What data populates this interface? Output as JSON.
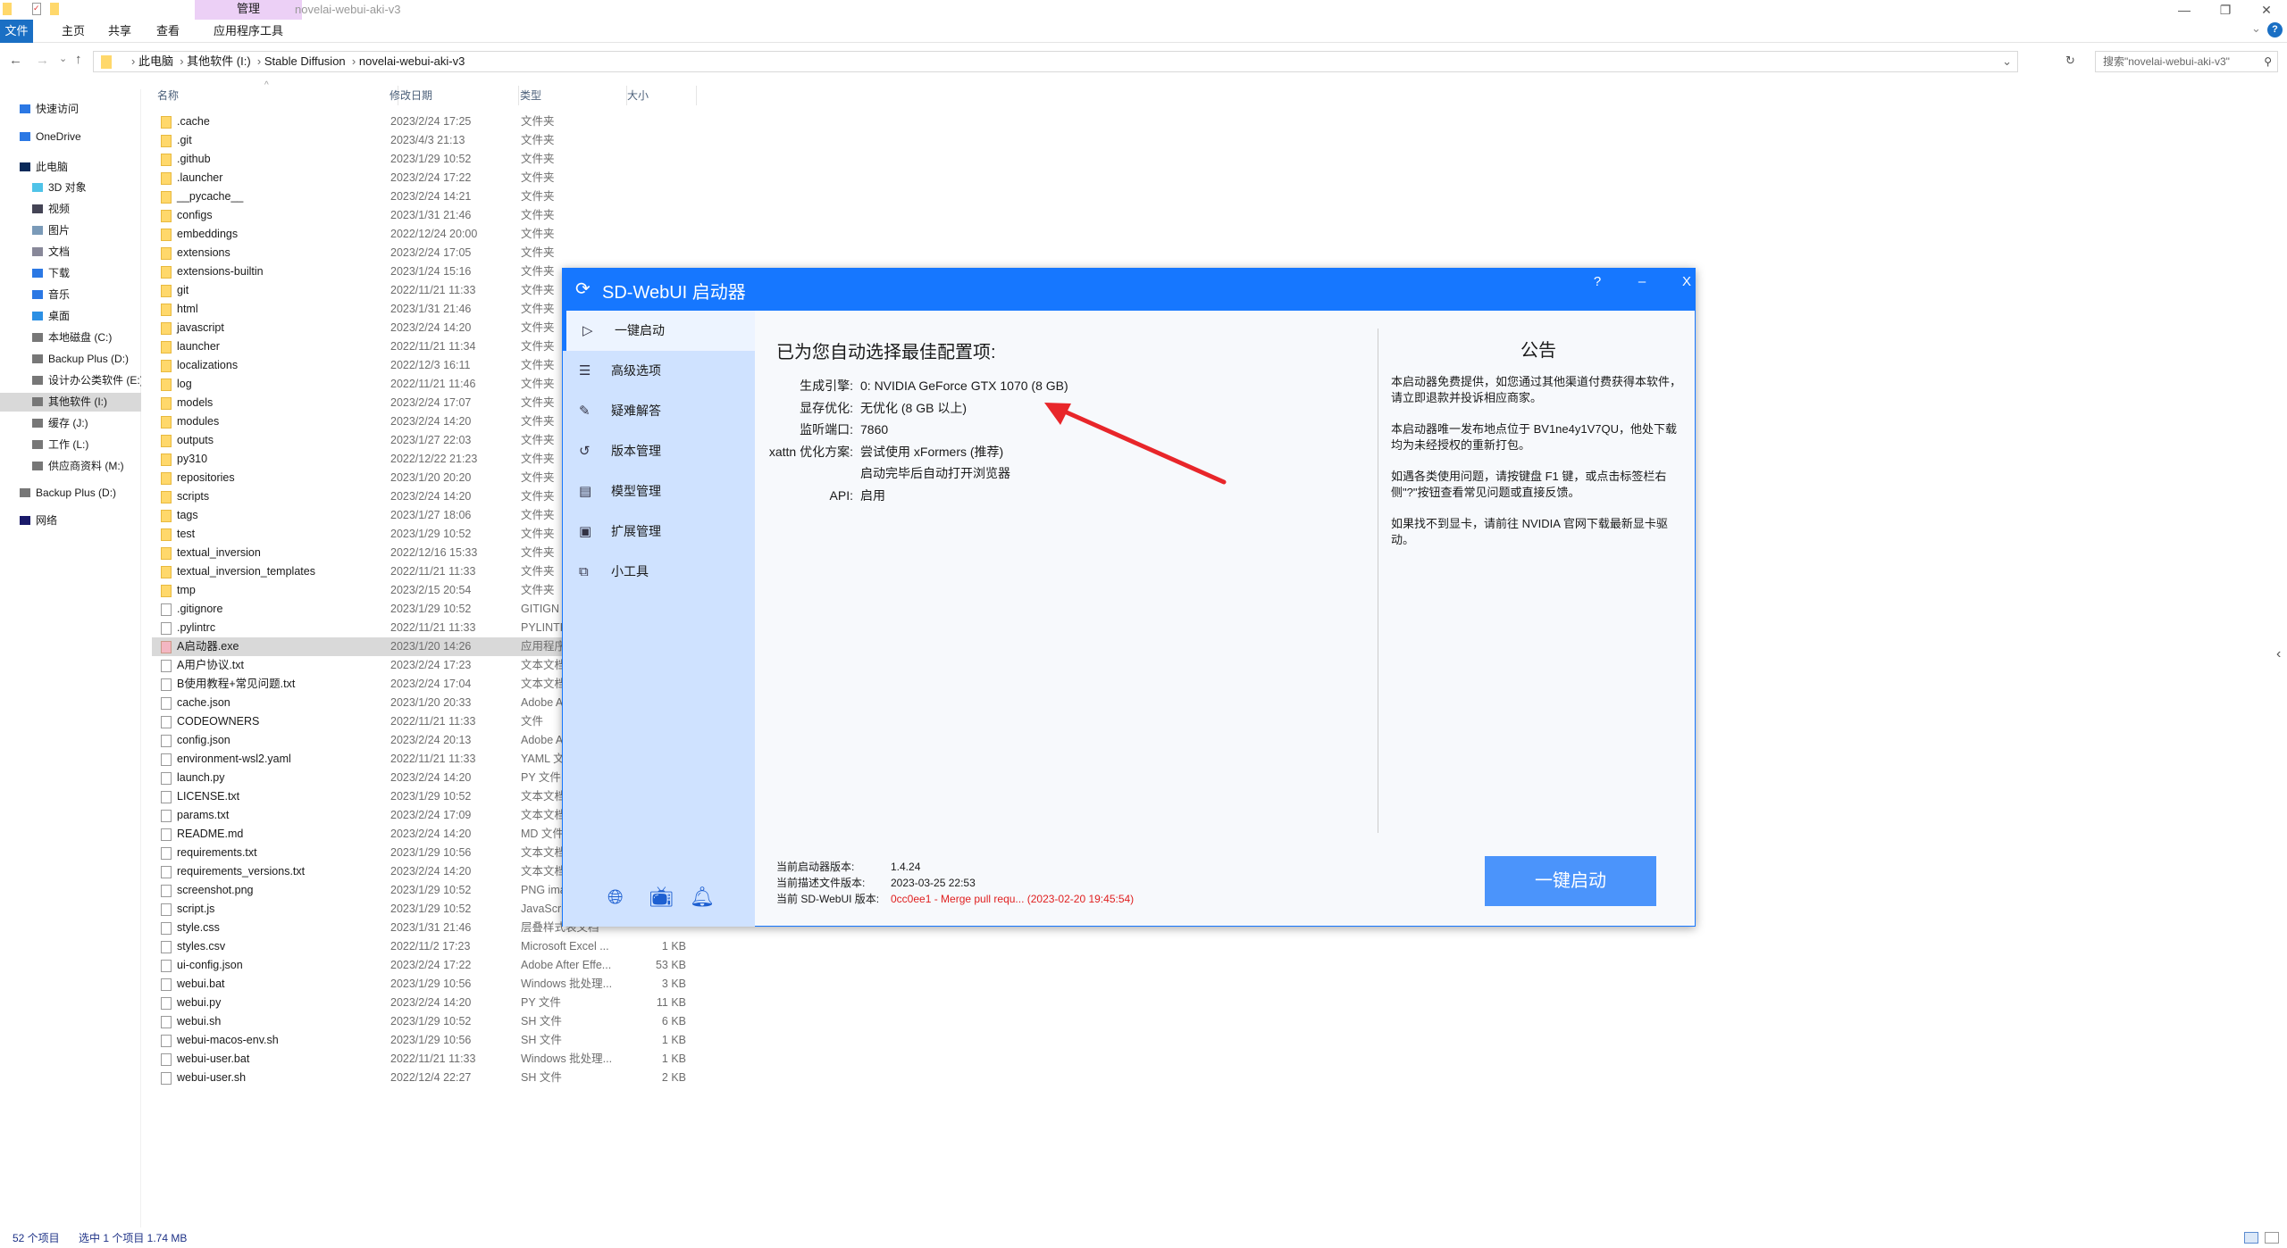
{
  "window": {
    "title": "novelai-webui-aki-v3",
    "manage_tab": "管理"
  },
  "ribbon": {
    "tabs": [
      "文件",
      "主页",
      "共享",
      "查看",
      "应用程序工具"
    ]
  },
  "address": {
    "crumbs": [
      "此电脑",
      "其他软件 (I:)",
      "Stable Diffusion",
      "novelai-webui-aki-v3"
    ],
    "search_placeholder": "搜索\"novelai-webui-aki-v3\""
  },
  "nav": {
    "items": [
      {
        "label": "快速访问",
        "icon": "star-icon",
        "color": "#2b78e4"
      },
      {
        "label": "OneDrive",
        "icon": "cloud-icon",
        "color": "#2b78e4"
      },
      {
        "label": "此电脑",
        "icon": "pc-icon",
        "color": "#0a2a5a"
      },
      {
        "label": "3D 对象",
        "icon": "cube-icon",
        "color": "#4fc3e8"
      },
      {
        "label": "视频",
        "icon": "video-icon",
        "color": "#445"
      },
      {
        "label": "图片",
        "icon": "picture-icon",
        "color": "#7a9ab8"
      },
      {
        "label": "文档",
        "icon": "document-icon",
        "color": "#889"
      },
      {
        "label": "下载",
        "icon": "download-icon",
        "color": "#2b78e4"
      },
      {
        "label": "音乐",
        "icon": "music-icon",
        "color": "#2b78e4"
      },
      {
        "label": "桌面",
        "icon": "desktop-icon",
        "color": "#2b8fe4"
      },
      {
        "label": "本地磁盘 (C:)",
        "icon": "drive-icon",
        "color": "#777"
      },
      {
        "label": "Backup Plus (D:)",
        "icon": "drive-icon",
        "color": "#777"
      },
      {
        "label": "设计办公类软件 (E:)",
        "icon": "drive-icon",
        "color": "#777"
      },
      {
        "label": "其他软件 (I:)",
        "icon": "drive-icon",
        "color": "#777",
        "selected": true
      },
      {
        "label": "缓存 (J:)",
        "icon": "drive-icon",
        "color": "#777"
      },
      {
        "label": "工作 (L:)",
        "icon": "drive-icon",
        "color": "#777"
      },
      {
        "label": "供应商资料 (M:)",
        "icon": "drive-icon",
        "color": "#777"
      },
      {
        "label": "Backup Plus (D:)",
        "icon": "drive-icon",
        "color": "#777"
      },
      {
        "label": "网络",
        "icon": "network-icon",
        "color": "#1a1a6a"
      }
    ]
  },
  "columns": [
    "名称",
    "修改日期",
    "类型",
    "大小"
  ],
  "files": [
    [
      ".cache",
      "2023/2/24 17:25",
      "文件夹",
      "",
      "folder"
    ],
    [
      ".git",
      "2023/4/3 21:13",
      "文件夹",
      "",
      "folder"
    ],
    [
      ".github",
      "2023/1/29 10:52",
      "文件夹",
      "",
      "folder"
    ],
    [
      ".launcher",
      "2023/2/24 17:22",
      "文件夹",
      "",
      "folder"
    ],
    [
      "__pycache__",
      "2023/2/24 14:21",
      "文件夹",
      "",
      "folder"
    ],
    [
      "configs",
      "2023/1/31 21:46",
      "文件夹",
      "",
      "folder"
    ],
    [
      "embeddings",
      "2022/12/24 20:00",
      "文件夹",
      "",
      "folder"
    ],
    [
      "extensions",
      "2023/2/24 17:05",
      "文件夹",
      "",
      "folder"
    ],
    [
      "extensions-builtin",
      "2023/1/24 15:16",
      "文件夹",
      "",
      "folder"
    ],
    [
      "git",
      "2022/11/21 11:33",
      "文件夹",
      "",
      "folder"
    ],
    [
      "html",
      "2023/1/31 21:46",
      "文件夹",
      "",
      "folder"
    ],
    [
      "javascript",
      "2023/2/24 14:20",
      "文件夹",
      "",
      "folder"
    ],
    [
      "launcher",
      "2022/11/21 11:34",
      "文件夹",
      "",
      "folder"
    ],
    [
      "localizations",
      "2022/12/3 16:11",
      "文件夹",
      "",
      "folder"
    ],
    [
      "log",
      "2022/11/21 11:46",
      "文件夹",
      "",
      "folder"
    ],
    [
      "models",
      "2023/2/24 17:07",
      "文件夹",
      "",
      "folder"
    ],
    [
      "modules",
      "2023/2/24 14:20",
      "文件夹",
      "",
      "folder"
    ],
    [
      "outputs",
      "2023/1/27 22:03",
      "文件夹",
      "",
      "folder"
    ],
    [
      "py310",
      "2022/12/22 21:23",
      "文件夹",
      "",
      "folder"
    ],
    [
      "repositories",
      "2023/1/20 20:20",
      "文件夹",
      "",
      "folder"
    ],
    [
      "scripts",
      "2023/2/24 14:20",
      "文件夹",
      "",
      "folder"
    ],
    [
      "tags",
      "2023/1/27 18:06",
      "文件夹",
      "",
      "folder"
    ],
    [
      "test",
      "2023/1/29 10:52",
      "文件夹",
      "",
      "folder"
    ],
    [
      "textual_inversion",
      "2022/12/16 15:33",
      "文件夹",
      "",
      "folder"
    ],
    [
      "textual_inversion_templates",
      "2022/11/21 11:33",
      "文件夹",
      "",
      "folder"
    ],
    [
      "tmp",
      "2023/2/15 20:54",
      "文件夹",
      "",
      "folder"
    ],
    [
      ".gitignore",
      "2023/1/29 10:52",
      "GITIGN",
      "",
      "file"
    ],
    [
      ".pylintrc",
      "2022/11/21 11:33",
      "PYLINTF",
      "",
      "file"
    ],
    [
      "A启动器.exe",
      "2023/1/20 14:26",
      "应用程序",
      "",
      "exe"
    ],
    [
      "A用户协议.txt",
      "2023/2/24 17:23",
      "文本文档",
      "",
      "file"
    ],
    [
      "B使用教程+常见问题.txt",
      "2023/2/24 17:04",
      "文本文档",
      "",
      "file"
    ],
    [
      "cache.json",
      "2023/1/20 20:33",
      "Adobe A",
      "",
      "file"
    ],
    [
      "CODEOWNERS",
      "2022/11/21 11:33",
      "文件",
      "",
      "file"
    ],
    [
      "config.json",
      "2023/2/24 20:13",
      "Adobe A",
      "",
      "file"
    ],
    [
      "environment-wsl2.yaml",
      "2022/11/21 11:33",
      "YAML 文",
      "",
      "file"
    ],
    [
      "launch.py",
      "2023/2/24 14:20",
      "PY 文件",
      "",
      "file"
    ],
    [
      "LICENSE.txt",
      "2023/1/29 10:52",
      "文本文档",
      "",
      "file"
    ],
    [
      "params.txt",
      "2023/2/24 17:09",
      "文本文档",
      "",
      "file"
    ],
    [
      "README.md",
      "2023/2/24 14:20",
      "MD 文件",
      "",
      "file"
    ],
    [
      "requirements.txt",
      "2023/1/29 10:56",
      "文本文档",
      "",
      "file"
    ],
    [
      "requirements_versions.txt",
      "2023/2/24 14:20",
      "文本文档",
      "",
      "file"
    ],
    [
      "screenshot.png",
      "2023/1/29 10:52",
      "PNG ima",
      "",
      "file"
    ],
    [
      "script.js",
      "2023/1/29 10:52",
      "JavaScri",
      "",
      "file"
    ],
    [
      "style.css",
      "2023/1/31 21:46",
      "层叠样式表文档",
      "",
      "file"
    ],
    [
      "styles.csv",
      "2022/11/2 17:23",
      "Microsoft Excel ...",
      "1 KB",
      "file"
    ],
    [
      "ui-config.json",
      "2023/2/24 17:22",
      "Adobe After Effe...",
      "53 KB",
      "file"
    ],
    [
      "webui.bat",
      "2023/1/29 10:56",
      "Windows 批处理...",
      "3 KB",
      "file"
    ],
    [
      "webui.py",
      "2023/2/24 14:20",
      "PY 文件",
      "11 KB",
      "file"
    ],
    [
      "webui.sh",
      "2023/1/29 10:52",
      "SH 文件",
      "6 KB",
      "file"
    ],
    [
      "webui-macos-env.sh",
      "2023/1/29 10:56",
      "SH 文件",
      "1 KB",
      "file"
    ],
    [
      "webui-user.bat",
      "2022/11/21 11:33",
      "Windows 批处理...",
      "1 KB",
      "file"
    ],
    [
      "webui-user.sh",
      "2022/12/4 22:27",
      "SH 文件",
      "2 KB",
      "file"
    ]
  ],
  "selected_file": "A启动器.exe",
  "status": {
    "count": "52 个项目",
    "selection": "选中 1 个项目  1.74 MB"
  },
  "dialog": {
    "title": "SD-WebUI 启动器",
    "help": "?",
    "minimize": "–",
    "close": "X",
    "menu": [
      {
        "label": "一键启动",
        "icon": "play-icon"
      },
      {
        "label": "高级选项",
        "icon": "list-icon"
      },
      {
        "label": "疑难解答",
        "icon": "wrench-icon"
      },
      {
        "label": "版本管理",
        "icon": "history-icon"
      },
      {
        "label": "模型管理",
        "icon": "archive-icon"
      },
      {
        "label": "扩展管理",
        "icon": "chip-icon"
      },
      {
        "label": "小工具",
        "icon": "tools-icon"
      }
    ],
    "footer_icons": [
      "globe-icon",
      "bilibili-icon",
      "qq-icon"
    ],
    "config_title": "已为您自动选择最佳配置项:",
    "config": [
      {
        "k": "生成引擎:",
        "v": "0: NVIDIA GeForce GTX 1070 (8 GB)"
      },
      {
        "k": "显存优化:",
        "v": "无优化 (8 GB 以上)"
      },
      {
        "k": "监听端口:",
        "v": "7860"
      },
      {
        "k": "xattn 优化方案:",
        "v": "尝试使用 xFormers (推荐)"
      },
      {
        "k": "",
        "v": "启动完毕后自动打开浏览器"
      },
      {
        "k": "API:",
        "v": "启用"
      }
    ],
    "notice_title": "公告",
    "notice": [
      "本启动器免费提供，如您通过其他渠道付费获得本软件，请立即退款并投诉相应商家。",
      "本启动器唯一发布地点位于 BV1ne4y1V7QU，他处下载均为未经授权的重新打包。",
      "如遇各类使用问题，请按键盘 F1 键，或点击标签栏右侧\"?\"按钮查看常见问题或直接反馈。",
      "如果找不到显卡，请前往 NVIDIA 官网下载最新显卡驱动。"
    ],
    "versions": [
      {
        "k": "当前启动器版本:",
        "v": "1.4.24"
      },
      {
        "k": "当前描述文件版本:",
        "v": "2023-03-25 22:53"
      },
      {
        "k": "当前 SD-WebUI 版本:",
        "v": "0cc0ee1 - Merge pull requ... (2023-02-20 19:45:54)",
        "warn": true
      }
    ],
    "launch_label": "一键启动",
    "colors": {
      "accent": "#1677ff",
      "sidebar": "#cfe2ff",
      "button": "#4b94fb",
      "warning": "#e02020",
      "arrow": "#e8262a"
    }
  }
}
